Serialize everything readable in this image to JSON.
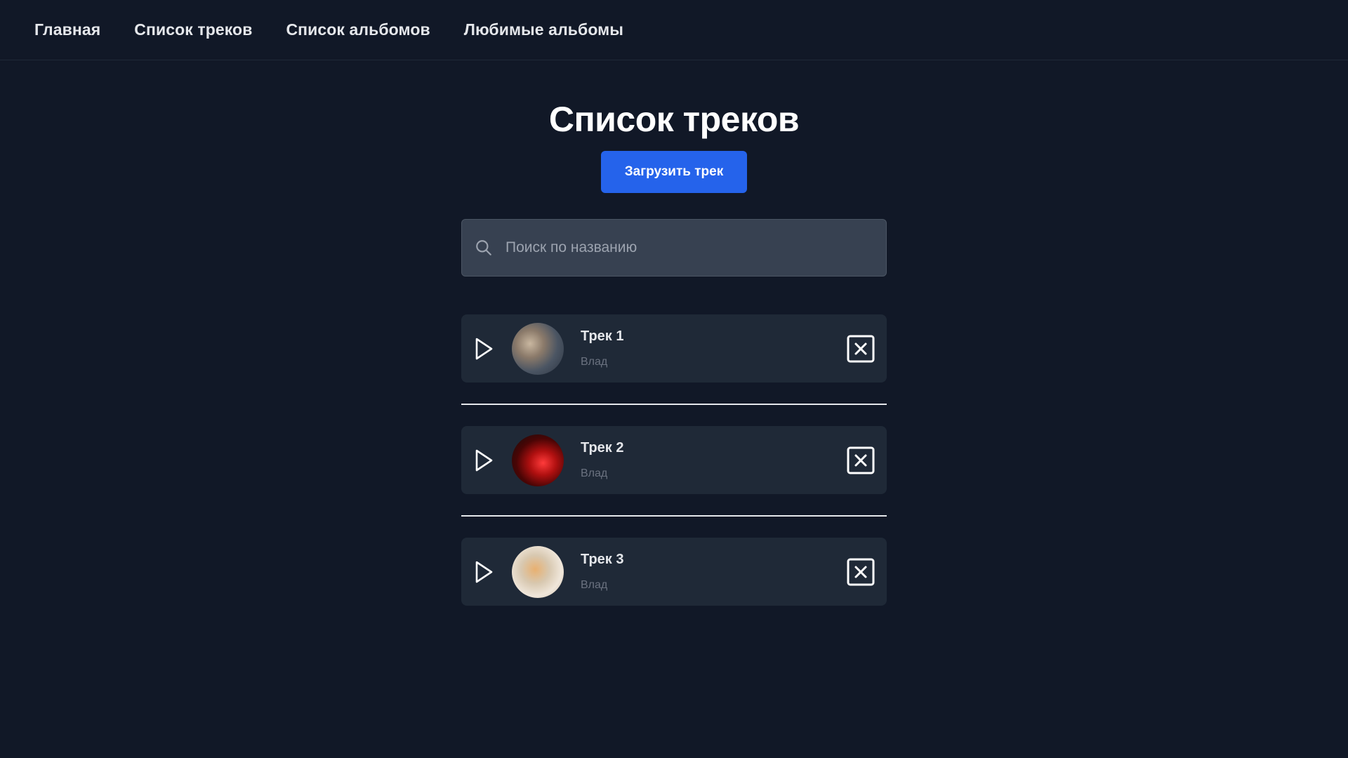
{
  "nav": {
    "items": [
      {
        "label": "Главная"
      },
      {
        "label": "Список треков"
      },
      {
        "label": "Список альбомов"
      },
      {
        "label": "Любимые альбомы"
      }
    ]
  },
  "main": {
    "title": "Список треков",
    "upload_button": "Загрузить трек",
    "search": {
      "placeholder": "Поиск по названию",
      "value": ""
    }
  },
  "tracks": [
    {
      "title": "Трек 1",
      "artist": "Влад"
    },
    {
      "title": "Трек 2",
      "artist": "Влад"
    },
    {
      "title": "Трек 3",
      "artist": "Влад"
    }
  ],
  "icons": {
    "search": "search-icon",
    "play": "play-icon",
    "delete": "close-square-icon"
  },
  "colors": {
    "background": "#111827",
    "card": "#1f2937",
    "accent": "#2563eb",
    "input": "#374151",
    "text_muted": "#6b7280"
  }
}
